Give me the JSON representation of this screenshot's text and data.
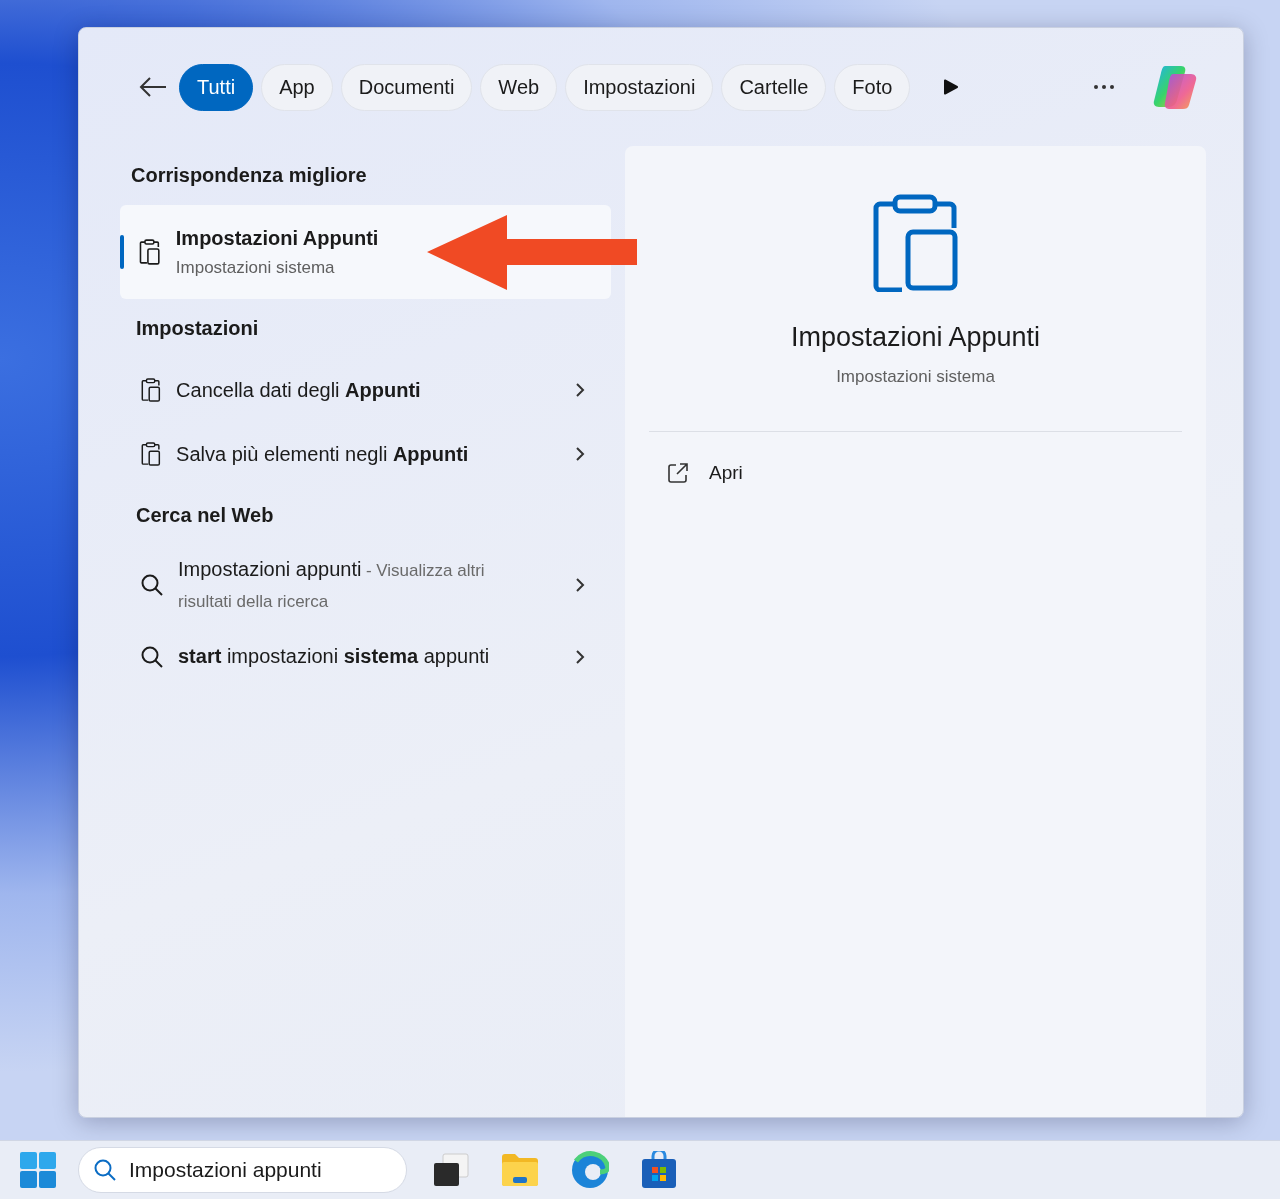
{
  "filter_tabs": [
    {
      "label": "Tutti",
      "selected": true
    },
    {
      "label": "App",
      "selected": false
    },
    {
      "label": "Documenti",
      "selected": false
    },
    {
      "label": "Web",
      "selected": false
    },
    {
      "label": "Impostazioni",
      "selected": false
    },
    {
      "label": "Cartelle",
      "selected": false
    },
    {
      "label": "Foto",
      "selected": false
    }
  ],
  "best_match": {
    "heading": "Corrispondenza migliore",
    "item": {
      "title": "Impostazioni Appunti",
      "subtitle": "Impostazioni sistema",
      "selected": true
    }
  },
  "settings": {
    "heading": "Impostazioni",
    "items": [
      {
        "text": "Cancella dati degli **Appunti**"
      },
      {
        "text": "Salva più elementi negli **Appunti**"
      }
    ]
  },
  "web": {
    "heading": "Cerca nel Web",
    "items": [
      {
        "title": "Impostazioni appunti",
        "hint": "- Visualizza altri risultati della ricerca"
      },
      {
        "title": "**start** impostazioni **sistema** appunti"
      }
    ]
  },
  "preview": {
    "title": "Impostazioni Appunti",
    "subtitle": "Impostazioni sistema",
    "actions": [
      {
        "label": "Apri"
      }
    ]
  },
  "taskbar": {
    "search": {
      "value": "Impostazioni appunti"
    }
  }
}
